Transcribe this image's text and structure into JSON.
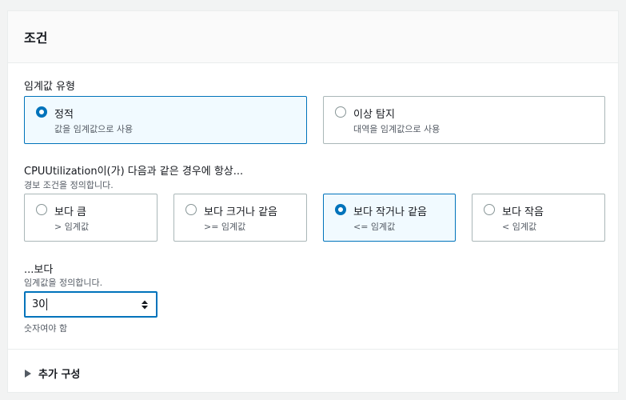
{
  "panel": {
    "title": "조건"
  },
  "threshold_type": {
    "label": "임계값 유형",
    "options": [
      {
        "title": "정적",
        "sub": "값을 임계값으로 사용",
        "selected": true
      },
      {
        "title": "이상 탐지",
        "sub": "대역을 임계값으로 사용",
        "selected": false
      }
    ]
  },
  "condition": {
    "label": "CPUUtilization이(가) 다음과 같은 경우에 항상...",
    "desc": "경보 조건을 정의합니다.",
    "options": [
      {
        "title": "보다 큼",
        "sub": "> 임계값",
        "selected": false
      },
      {
        "title": "보다 크거나 같음",
        "sub": ">= 임계값",
        "selected": false
      },
      {
        "title": "보다 작거나 같음",
        "sub": "<= 임계값",
        "selected": true
      },
      {
        "title": "보다 작음",
        "sub": "< 임계값",
        "selected": false
      }
    ]
  },
  "threshold": {
    "label": "...보다",
    "desc": "임계값을 정의합니다.",
    "value": "30",
    "hint": "숫자여야 함"
  },
  "additional": {
    "label": "추가 구성",
    "icon": "caret-right-icon"
  },
  "colors": {
    "accent": "#0073bb",
    "selected_bg": "#f1faff",
    "border": "#aab7b8"
  }
}
